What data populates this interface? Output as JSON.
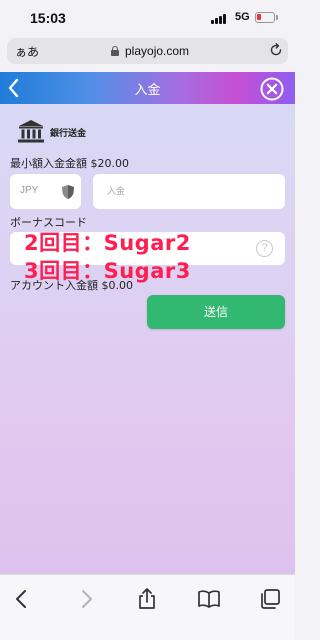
{
  "status_bar": {
    "time": "15:03",
    "network": "5G",
    "battery_level": 0.2,
    "battery_color": "#ee3333"
  },
  "browser": {
    "text_size_label": "ぁあ",
    "url": "playojo.com",
    "lock_icon": "lock-icon",
    "reload_icon": "reload-icon"
  },
  "header": {
    "title": "入金",
    "back_icon": "chevron-left-icon",
    "close_icon": "close-circle-icon"
  },
  "form": {
    "method_label": "銀行送金",
    "method_icon": "bank-icon",
    "min_deposit": "最小額入金金額 $20.00",
    "currency": "JPY",
    "currency_icon": "shield-icon",
    "amount_placeholder": "入金",
    "bonus_label": "ボーナスコード",
    "help_symbol": "?",
    "account_deposit": "アカウント入金額  $0.00",
    "submit_label": "送信"
  },
  "overlay_annotation": {
    "line1": "2回目：Sugar2",
    "line2": "3回目：Sugar3",
    "color": "#ff1e50"
  },
  "bottom_toolbar": {
    "icons": [
      "back-icon",
      "forward-icon",
      "share-icon",
      "bookmarks-icon",
      "tabs-icon"
    ]
  },
  "colors": {
    "submit_button": "#33b872",
    "header_gradient_start": "#1f7cd8",
    "header_gradient_end": "#8e5ef0"
  }
}
